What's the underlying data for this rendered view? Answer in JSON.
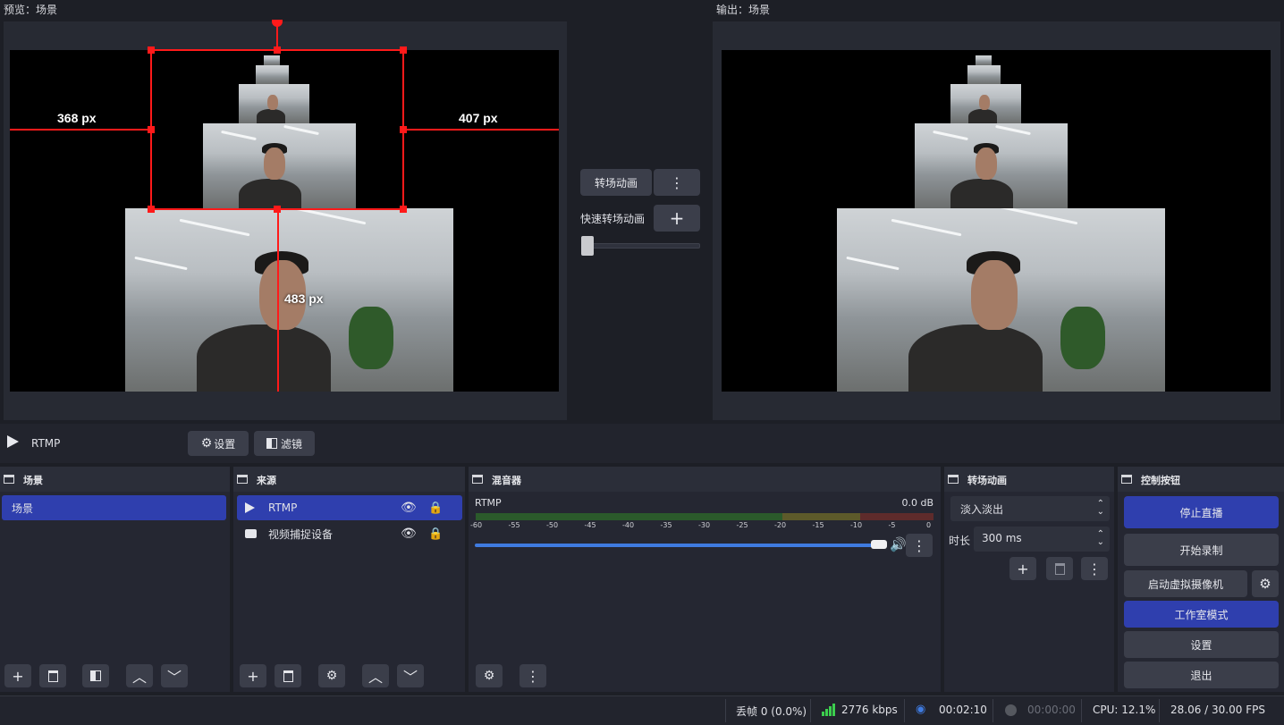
{
  "preview": {
    "title": "预览：场景",
    "labels": {
      "left": "368 px",
      "right": "407 px",
      "bottom": "483 px"
    }
  },
  "output": {
    "title": "输出：场景"
  },
  "transition_center": {
    "transition_button": "转场动画",
    "quick_label": "快速转场动画"
  },
  "source_bar": {
    "source_name": "RTMP",
    "settings_label": "设置",
    "filters_label": "滤镜"
  },
  "docks": {
    "scenes": {
      "title": "场景",
      "items": [
        "场景"
      ]
    },
    "sources": {
      "title": "来源",
      "items": [
        {
          "label": "RTMP",
          "icon": "play-icon"
        },
        {
          "label": "视频捕捉设备",
          "icon": "camera-icon"
        }
      ]
    },
    "mixer": {
      "title": "混音器",
      "track_name": "RTMP",
      "level": "0.0 dB",
      "ticks": [
        "-60",
        "-55",
        "-50",
        "-45",
        "-40",
        "-35",
        "-30",
        "-25",
        "-20",
        "-15",
        "-10",
        "-5",
        "0"
      ],
      "volume": 1.0
    },
    "transitions": {
      "title": "转场动画",
      "selected": "淡入淡出",
      "duration_label": "时长",
      "duration_value": "300 ms"
    },
    "controls": {
      "title": "控制按钮",
      "stop_stream": "停止直播",
      "start_record": "开始录制",
      "virtual_cam": "启动虚拟摄像机",
      "studio_mode": "工作室模式",
      "settings": "设置",
      "exit": "退出"
    }
  },
  "status": {
    "dropped": "丢帧 0 (0.0%)",
    "bitrate": "2776 kbps",
    "stream_time": "00:02:10",
    "record_time": "00:00:00",
    "cpu": "CPU: 12.1%",
    "fps": "28.06 / 30.00 FPS"
  },
  "colors": {
    "accent": "#2f3fae",
    "selection": "#ff1a1a",
    "bitrate_bars": "#3ccf4e",
    "stream_indicator": "#3f7be0"
  }
}
